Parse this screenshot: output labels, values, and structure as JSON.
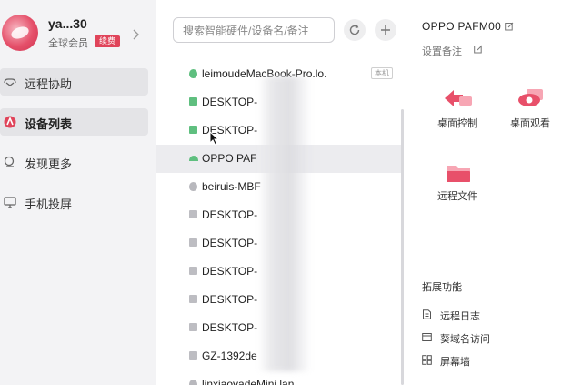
{
  "profile": {
    "username": "ya...30",
    "member_label": "全球会员",
    "renew_badge": "续费"
  },
  "sidebar": {
    "items": [
      {
        "label": "远程协助",
        "icon": "remote-assist-icon"
      },
      {
        "label": "设备列表",
        "icon": "device-list-icon"
      },
      {
        "label": "发现更多",
        "icon": "discover-icon"
      },
      {
        "label": "手机投屏",
        "icon": "screen-cast-icon"
      }
    ]
  },
  "search": {
    "placeholder": "搜索智能硬件/设备名/备注"
  },
  "devices": [
    {
      "name": "leimoudeMacBook-Pro.lo.",
      "icon": "apple-icon",
      "tag": "本机"
    },
    {
      "name": "DESKTOP-",
      "icon": "windows-icon"
    },
    {
      "name": "DESKTOP-",
      "icon": "windows-icon"
    },
    {
      "name": "OPPO PAF",
      "icon": "android-icon"
    },
    {
      "name": "beiruis-MBF",
      "icon": "apple-icon"
    },
    {
      "name": "DESKTOP-",
      "icon": "windows-icon"
    },
    {
      "name": "DESKTOP-",
      "icon": "windows-icon"
    },
    {
      "name": "DESKTOP-",
      "icon": "windows-icon"
    },
    {
      "name": "DESKTOP-",
      "icon": "windows-icon"
    },
    {
      "name": "DESKTOP-",
      "icon": "windows-icon"
    },
    {
      "name": "GZ-1392de",
      "icon": "windows-icon"
    },
    {
      "name": "linxiaoyadeMini.lan",
      "icon": "apple-icon"
    }
  ],
  "detail": {
    "device_name": "OPPO PAFM00",
    "remark_label": "设置备注",
    "actions": [
      {
        "label": "桌面控制",
        "icon": "desktop-control-icon"
      },
      {
        "label": "桌面观看",
        "icon": "desktop-view-icon"
      },
      {
        "label": "远程文件",
        "icon": "remote-file-icon"
      }
    ],
    "extensions_title": "拓展功能",
    "extensions": [
      {
        "label": "远程日志",
        "icon": "log-icon"
      },
      {
        "label": "葵域名访问",
        "icon": "domain-icon"
      },
      {
        "label": "屏幕墙",
        "icon": "screen-wall-icon"
      }
    ]
  },
  "colors": {
    "accent": "#e0445a",
    "online": "#5fbf7f",
    "offline": "#bdbdc2",
    "sidebar_bg": "#f3f3f5"
  }
}
